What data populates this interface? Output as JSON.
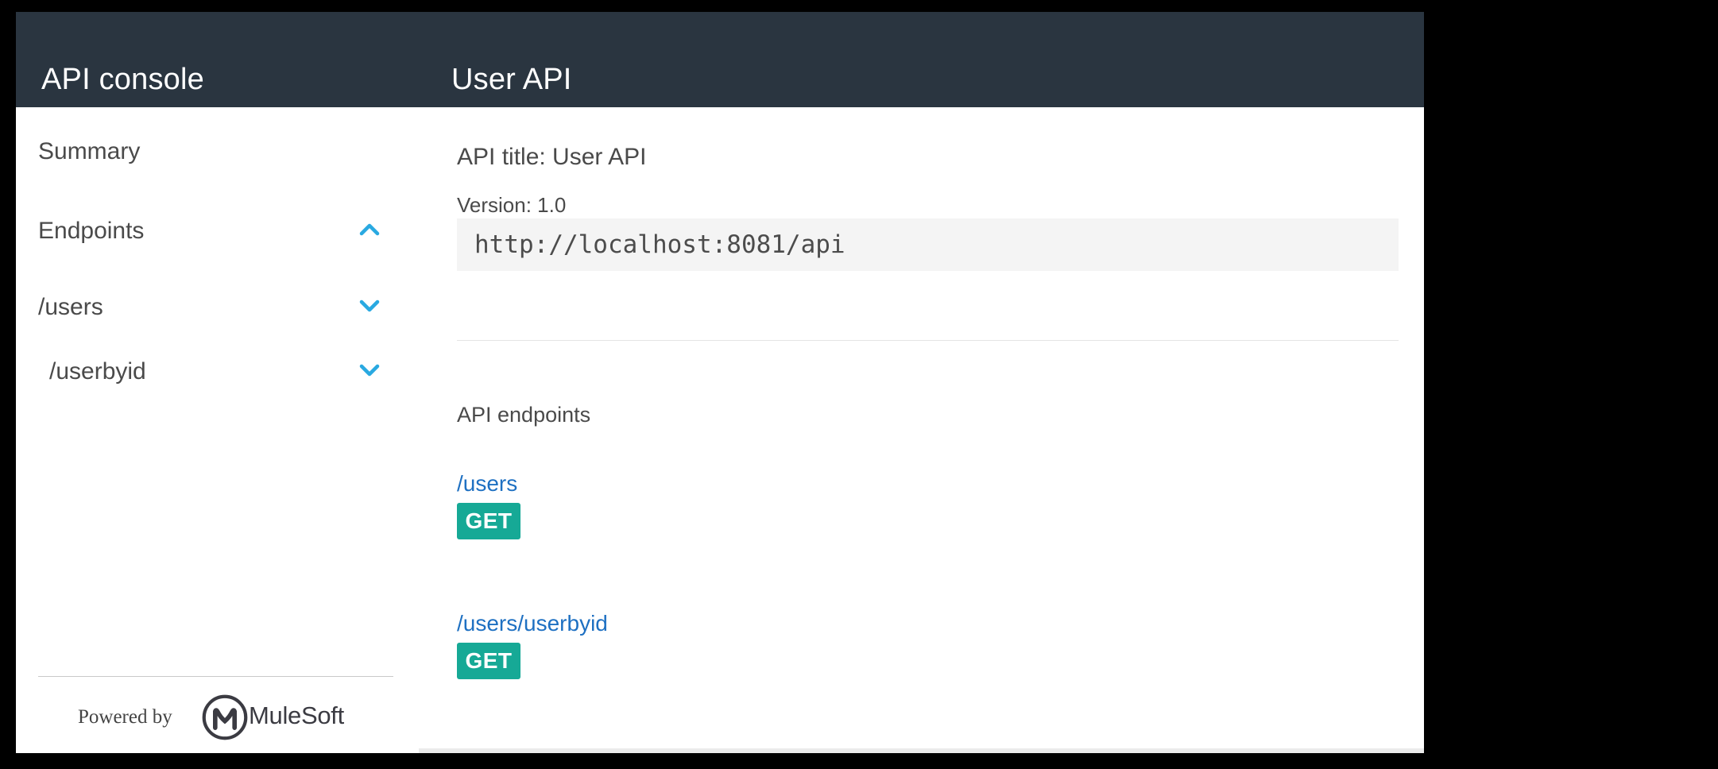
{
  "header": {
    "app_title": "API console",
    "api_title": "User API"
  },
  "sidebar": {
    "items": [
      {
        "label": "Summary",
        "chevron": "none"
      },
      {
        "label": "Endpoints",
        "chevron": "up"
      },
      {
        "label": "/users",
        "chevron": "down"
      },
      {
        "label": "/userbyid",
        "chevron": "down",
        "indented": true
      }
    ],
    "footer": {
      "powered_by": "Powered by",
      "brand": "MuleSoft",
      "logo_icon": "mulesoft-logo"
    }
  },
  "main": {
    "api_title_label": "API title: User API",
    "version_label": "Version: 1.0",
    "base_url": "http://localhost:8081/api",
    "endpoints_heading": "API endpoints",
    "endpoints": [
      {
        "path": "/users",
        "method": "GET"
      },
      {
        "path": "/users/userbyid",
        "method": "GET"
      }
    ]
  },
  "colors": {
    "header_bg": "#2a3540",
    "text": "#4a4a4a",
    "link_blue": "#1e70c2",
    "chevron_blue": "#29a9e1",
    "get_bg": "#16a996",
    "code_bg": "#f4f4f4",
    "divider": "#e4e4e4"
  }
}
